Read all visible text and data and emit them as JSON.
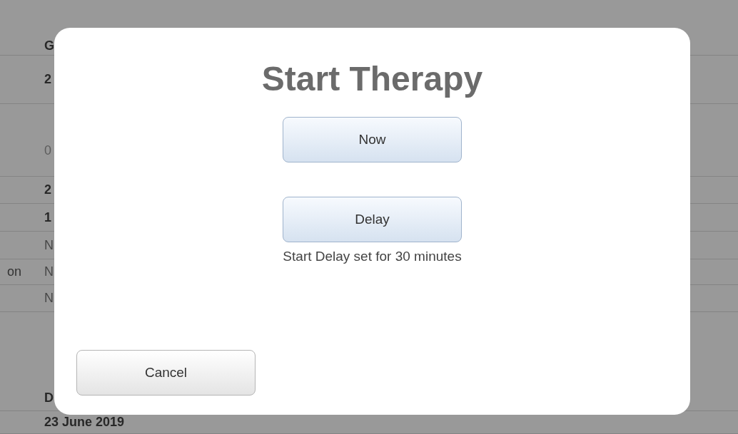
{
  "background": {
    "rows": [
      {
        "value": "G",
        "kind": "bold"
      },
      {
        "value": "2",
        "kind": "bold"
      },
      {
        "value": "0",
        "kind": "light"
      },
      {
        "value": "2",
        "kind": "bold"
      },
      {
        "value": "1",
        "kind": "bold"
      },
      {
        "value": "N",
        "kind": "plain"
      },
      {
        "label": "on",
        "value": "N",
        "kind": "plain"
      },
      {
        "value": "N",
        "kind": "plain"
      },
      {
        "value": "D",
        "kind": "bold"
      },
      {
        "value": "23 June 2019",
        "kind": "bold"
      }
    ]
  },
  "dialog": {
    "title": "Start Therapy",
    "buttons": [
      {
        "label": "Now",
        "kind": "primary"
      },
      {
        "label": "Delay",
        "kind": "primary"
      }
    ],
    "caption": "Start Delay set for 30 minutes",
    "cancel": "Cancel"
  }
}
